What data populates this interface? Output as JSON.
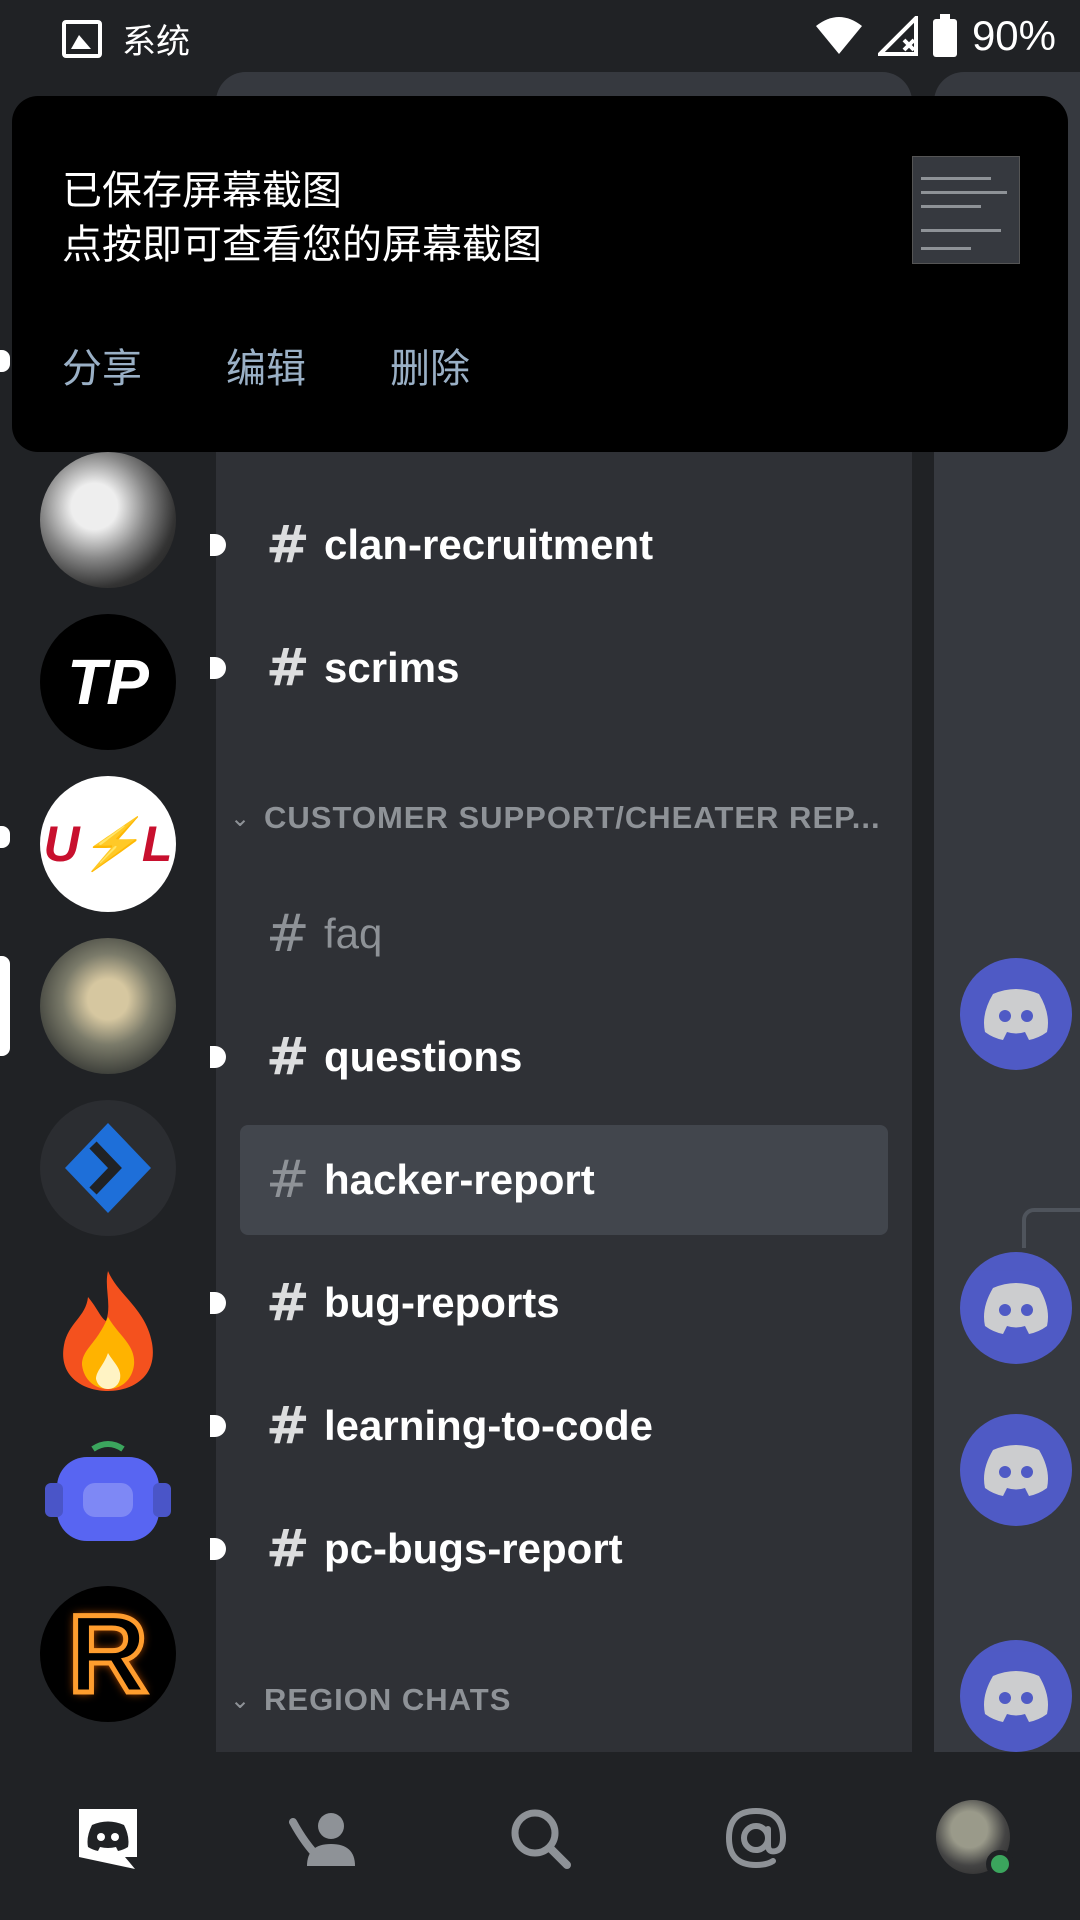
{
  "status_bar": {
    "app_label": "系统",
    "battery": "90%"
  },
  "toast": {
    "title": "已保存屏幕截图",
    "subtitle": "点按即可查看您的屏幕截图",
    "actions": [
      "分享",
      "编辑",
      "删除"
    ]
  },
  "channels": {
    "items": [
      {
        "hash": "#",
        "name": "clan-recruitment"
      },
      {
        "hash": "#",
        "name": "scrims"
      },
      {
        "hash": "#",
        "name": "faq"
      },
      {
        "hash": "#",
        "name": "questions"
      },
      {
        "hash": "#",
        "name": "hacker-report"
      },
      {
        "hash": "#",
        "name": "bug-reports"
      },
      {
        "hash": "#",
        "name": "learning-to-code"
      },
      {
        "hash": "#",
        "name": "pc-bugs-report"
      }
    ],
    "categories": [
      {
        "label": "CUSTOMER SUPPORT/CHEATER REP..."
      },
      {
        "label": "REGION CHATS"
      }
    ]
  },
  "servers": {
    "tp_label": "TP",
    "usl_label": "U⚡L",
    "r_label": "R"
  },
  "bottom_nav": {
    "items": [
      "discord-home-icon",
      "friends-icon",
      "search-icon",
      "mentions-icon",
      "profile-avatar"
    ]
  },
  "colors": {
    "accent": "#5865f2",
    "panel": "#2f3136",
    "rail": "#202225",
    "online": "#3ba55d"
  }
}
